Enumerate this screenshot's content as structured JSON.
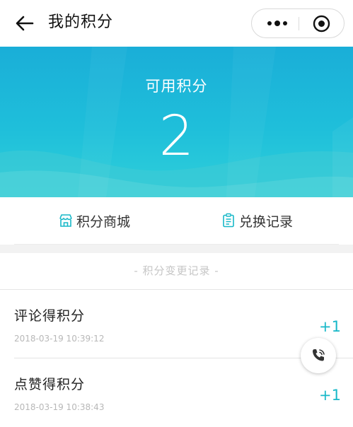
{
  "nav": {
    "title": "我的积分"
  },
  "hero": {
    "label": "可用积分",
    "points": "2"
  },
  "actions": {
    "mall": "积分商城",
    "records": "兑换记录"
  },
  "section_title": "- 积分变更记录 -",
  "records": [
    {
      "name": "评论得积分",
      "time": "2018-03-19 10:39:12",
      "points": "+1"
    },
    {
      "name": "点赞得积分",
      "time": "2018-03-19 10:38:43",
      "points": "+1"
    }
  ],
  "colors": {
    "accent": "#18b8c8",
    "hero_top": "#1aaed8",
    "hero_bottom": "#2fd0d9"
  },
  "icons": [
    "back-arrow-icon",
    "more-dots-icon",
    "target-circle-icon",
    "shop-icon",
    "clipboard-icon",
    "phone-icon"
  ]
}
